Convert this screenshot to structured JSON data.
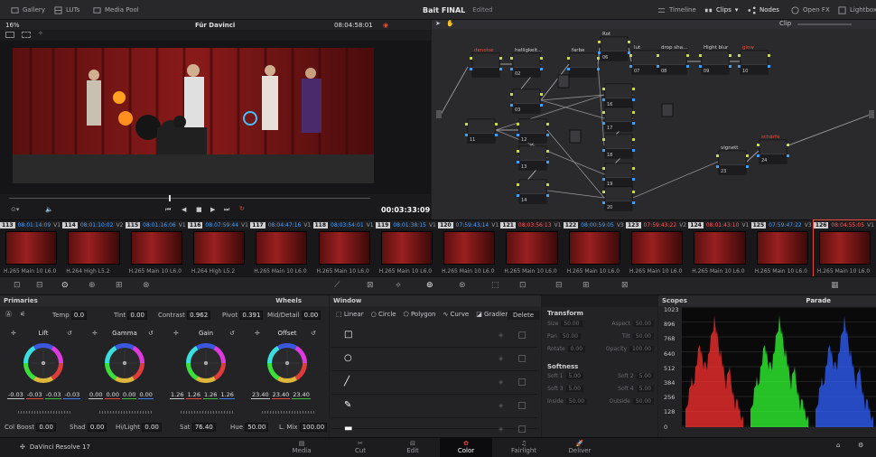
{
  "topbar": {
    "left": [
      {
        "icon": "gallery-icon",
        "label": "Gallery"
      },
      {
        "icon": "luts-icon",
        "label": "LUTs"
      },
      {
        "icon": "media-pool-icon",
        "label": "Media Pool"
      }
    ],
    "project_title": "Bait FINAL",
    "project_status": "Edited",
    "right": [
      {
        "icon": "timeline-icon",
        "label": "Timeline"
      },
      {
        "icon": "clips-icon",
        "label": "Clips"
      },
      {
        "icon": "nodes-icon",
        "label": "Nodes"
      },
      {
        "icon": "openfx-icon",
        "label": "Open FX"
      },
      {
        "icon": "lightbox-icon",
        "label": "Lightbox"
      }
    ]
  },
  "viewer": {
    "zoom": "16%",
    "timeline_name": "Für Davinci",
    "timecode_top": "08:04:58:01",
    "timecode": "00:03:33:09",
    "clip_mode": "Clip"
  },
  "nodes": [
    {
      "num": "",
      "label": "denoise",
      "red": true
    },
    {
      "num": "02",
      "label": "helligkeit...",
      "red": false
    },
    {
      "num": "03",
      "label": "",
      "red": false
    },
    {
      "num": "",
      "label": "farbe",
      "red": false
    },
    {
      "num": "06",
      "label": "Rot",
      "red": false
    },
    {
      "num": "07",
      "label": "lut",
      "red": false
    },
    {
      "num": "08",
      "label": "drop sha...",
      "red": false
    },
    {
      "num": "09",
      "label": "Hight blur",
      "red": false
    },
    {
      "num": "10",
      "label": "glow",
      "red": true
    },
    {
      "num": "11",
      "label": "",
      "red": false
    },
    {
      "num": "12",
      "label": "",
      "red": false
    },
    {
      "num": "13",
      "label": "",
      "red": false
    },
    {
      "num": "14",
      "label": "",
      "red": false
    },
    {
      "num": "16",
      "label": "",
      "red": false
    },
    {
      "num": "17",
      "label": "",
      "red": false
    },
    {
      "num": "18",
      "label": "",
      "red": false
    },
    {
      "num": "19",
      "label": "",
      "red": false
    },
    {
      "num": "20",
      "label": "",
      "red": false
    },
    {
      "num": "23",
      "label": "vignett",
      "red": false
    },
    {
      "num": "24",
      "label": "schärfe",
      "red": true
    }
  ],
  "clips": [
    {
      "num": "113",
      "tc": "08:01:14:09",
      "track": "V1",
      "red": false,
      "codec": "H.265 Main 10 L6.0"
    },
    {
      "num": "114",
      "tc": "08:01:10:02",
      "track": "V2",
      "red": false,
      "codec": "H.264 High L5.2"
    },
    {
      "num": "115",
      "tc": "08:01:16:06",
      "track": "V1",
      "red": false,
      "codec": "H.265 Main 10 L6.0"
    },
    {
      "num": "116",
      "tc": "08:07:59:44",
      "track": "V1",
      "red": false,
      "codec": "H.264 High L5.2"
    },
    {
      "num": "117",
      "tc": "08:04:47:16",
      "track": "V1",
      "red": false,
      "codec": "H.265 Main 10 L6.0"
    },
    {
      "num": "118",
      "tc": "08:03:54:01",
      "track": "V1",
      "red": false,
      "codec": "H.265 Main 10 L6.0"
    },
    {
      "num": "119",
      "tc": "08:01:38:15",
      "track": "V1",
      "red": false,
      "codec": "H.265 Main 10 L6.0"
    },
    {
      "num": "120",
      "tc": "07:59:43:14",
      "track": "V1",
      "red": false,
      "codec": "H.265 Main 10 L6.0"
    },
    {
      "num": "121",
      "tc": "08:03:56:13",
      "track": "V1",
      "red": true,
      "codec": "H.265 Main 10 L6.0"
    },
    {
      "num": "122",
      "tc": "08:00:59:05",
      "track": "V3",
      "red": false,
      "codec": "H.265 Main 10 L6.0"
    },
    {
      "num": "123",
      "tc": "07:59:43:22",
      "track": "V2",
      "red": true,
      "codec": "H.265 Main 10 L6.0"
    },
    {
      "num": "124",
      "tc": "08:01:43:10",
      "track": "V1",
      "red": true,
      "codec": "H.265 Main 10 L6.0"
    },
    {
      "num": "125",
      "tc": "07:59:47:22",
      "track": "V3",
      "red": false,
      "codec": "H.265 Main 10 L6.0"
    },
    {
      "num": "126",
      "tc": "08:04:55:05",
      "track": "V1",
      "red": true,
      "codec": "H.265 Main 10 L6.0"
    }
  ],
  "primaries": {
    "title": "Primaries",
    "mode": "Wheels",
    "temp_label": "Temp",
    "temp": "0.0",
    "tint_label": "Tint",
    "tint": "0.00",
    "contrast_label": "Contrast",
    "contrast": "0.962",
    "pivot_label": "Pivot",
    "pivot": "0.391",
    "middetail_label": "Mid/Detail",
    "middetail": "0.00",
    "wheels": [
      {
        "name": "Lift",
        "values": [
          "-0.03",
          "-0.03",
          "-0.03",
          "-0.03"
        ]
      },
      {
        "name": "Gamma",
        "values": [
          "0.00",
          "0.00",
          "0.00",
          "0.00"
        ]
      },
      {
        "name": "Gain",
        "values": [
          "1.26",
          "1.26",
          "1.26",
          "1.26"
        ]
      },
      {
        "name": "Offset",
        "values": [
          "23.40",
          "23.40",
          "23.40"
        ]
      }
    ],
    "colboost_label": "Col Boost",
    "colboost": "0.00",
    "shad_label": "Shad",
    "shad": "0.00",
    "hilight_label": "Hi/Light",
    "hilight": "0.00",
    "sat_label": "Sat",
    "sat": "76.40",
    "hue_label": "Hue",
    "hue": "50.00",
    "lmix_label": "L. Mix",
    "lmix": "100.00"
  },
  "window": {
    "title": "Window",
    "tools": [
      "Linear",
      "Circle",
      "Polygon",
      "Curve",
      "Gradient"
    ],
    "delete": "Delete"
  },
  "transform": {
    "title": "Transform",
    "rows": [
      [
        "Size",
        "50.00",
        "Aspect",
        "50.00"
      ],
      [
        "Pan",
        "50.00",
        "Tilt",
        "50.00"
      ],
      [
        "Rotate",
        "0.00",
        "Opacity",
        "100.00"
      ]
    ],
    "softness_title": "Softness",
    "soft_rows": [
      [
        "Soft 1",
        "5.00",
        "Soft 2",
        "5.00"
      ],
      [
        "Soft 3",
        "5.00",
        "Soft 4",
        "5.00"
      ],
      [
        "Inside",
        "50.00",
        "Outside",
        "50.00"
      ]
    ]
  },
  "scopes": {
    "title": "Scopes",
    "mode": "Parade",
    "scale": [
      "1023",
      "896",
      "768",
      "640",
      "512",
      "384",
      "256",
      "128",
      "0"
    ]
  },
  "pages": [
    "Media",
    "Cut",
    "Edit",
    "Color",
    "Fairlight",
    "Deliver"
  ],
  "active_page": "Color",
  "app_name": "DaVinci Resolve 17",
  "colors": {
    "accent": "#e64b3b",
    "timecode_blue": "#43a0ff",
    "bg": "#1d1d20"
  }
}
